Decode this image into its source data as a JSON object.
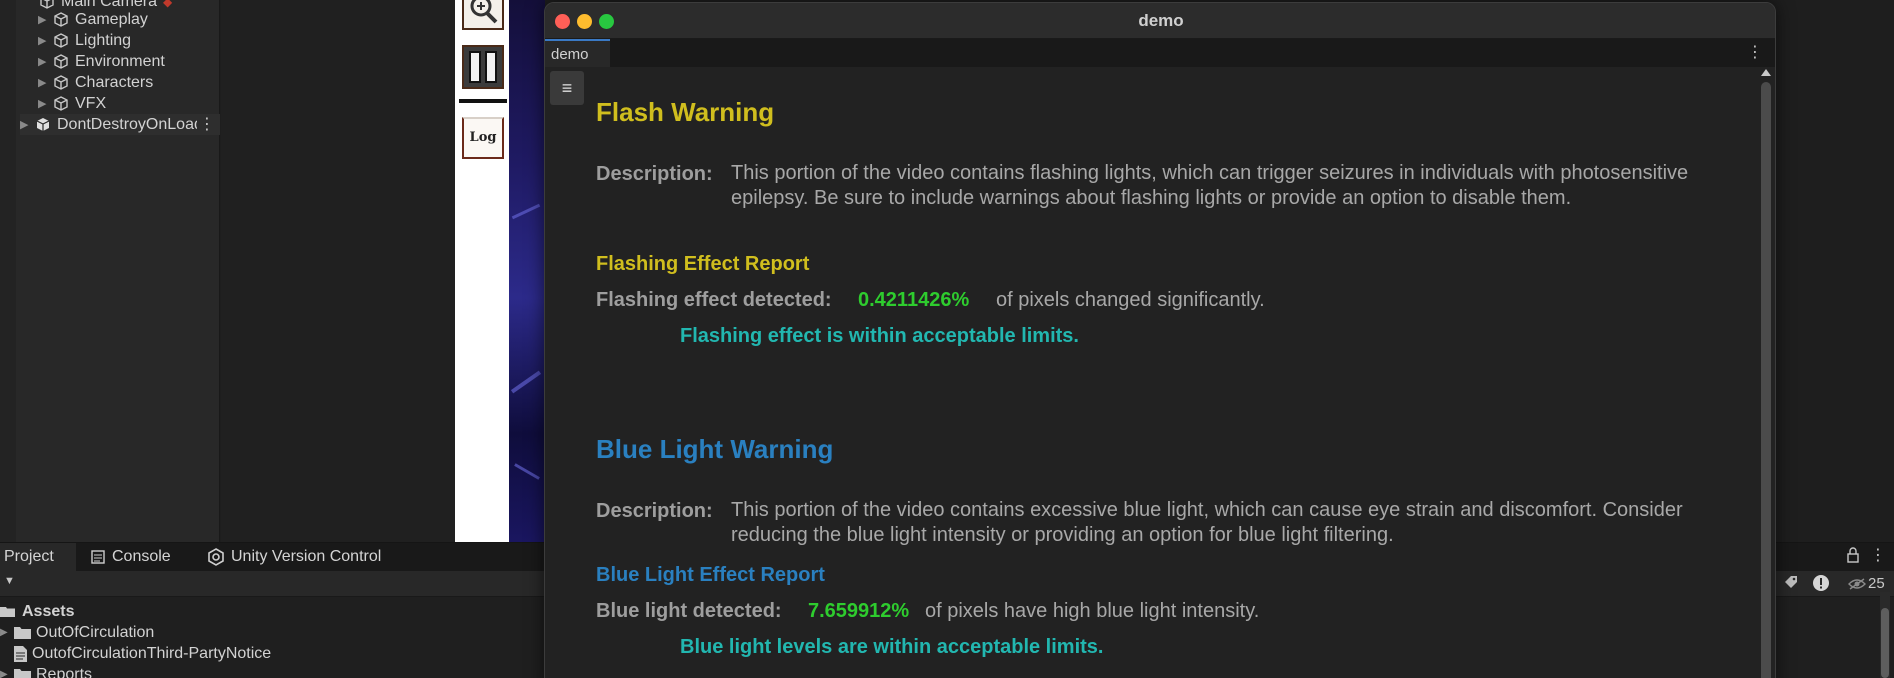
{
  "hierarchy": {
    "items": [
      {
        "label": "Main Camera"
      },
      {
        "label": "Gameplay"
      },
      {
        "label": "Lighting"
      },
      {
        "label": "Environment"
      },
      {
        "label": "Characters"
      },
      {
        "label": "VFX"
      },
      {
        "label": "DontDestroyOnLoad"
      }
    ],
    "kebab": "⋮"
  },
  "scene": {
    "log_label": "Log"
  },
  "bottom": {
    "tabs": [
      {
        "label": "Project"
      },
      {
        "label": "Console"
      },
      {
        "label": "Unity Version Control"
      }
    ],
    "toolbar_dropdown": "▼",
    "visibility_count": "25",
    "assets": [
      {
        "label": "Assets"
      },
      {
        "label": "OutOfCirculation"
      },
      {
        "label": "OutofCirculationThird-PartyNotice"
      },
      {
        "label": "Reports"
      }
    ]
  },
  "window": {
    "title": "demo",
    "tab_label": "demo",
    "tab_kebab": "⋮",
    "menu_icon": "≡"
  },
  "flash": {
    "heading": "Flash Warning",
    "desc_label": "Description:",
    "desc_text": "This portion of the video contains flashing lights, which can trigger seizures in individuals with photosensitive epilepsy. Be sure to include warnings about flashing lights or provide an option to disable them.",
    "report_heading": "Flashing Effect Report",
    "detected_label": "Flashing effect detected:",
    "detected_value": "0.4211426%",
    "detected_suffix": "of pixels changed significantly.",
    "status": "Flashing effect is within acceptable limits."
  },
  "blue": {
    "heading": "Blue Light Warning",
    "desc_label": "Description:",
    "desc_text": "This portion of the video contains excessive blue light, which can cause eye strain and discomfort. Consider reducing the blue light intensity or providing an option for blue light filtering.",
    "report_heading": "Blue Light Effect Report",
    "detected_label": "Blue light detected:",
    "detected_value": "7.659912%",
    "detected_suffix": "of pixels have high blue light intensity.",
    "status": "Blue light levels are within acceptable limits."
  },
  "colors": {
    "flash_accent": "#d0be1e",
    "blue_accent": "#2a80c0",
    "value_green": "#2ecc2e",
    "status_teal": "#22b7b0"
  }
}
